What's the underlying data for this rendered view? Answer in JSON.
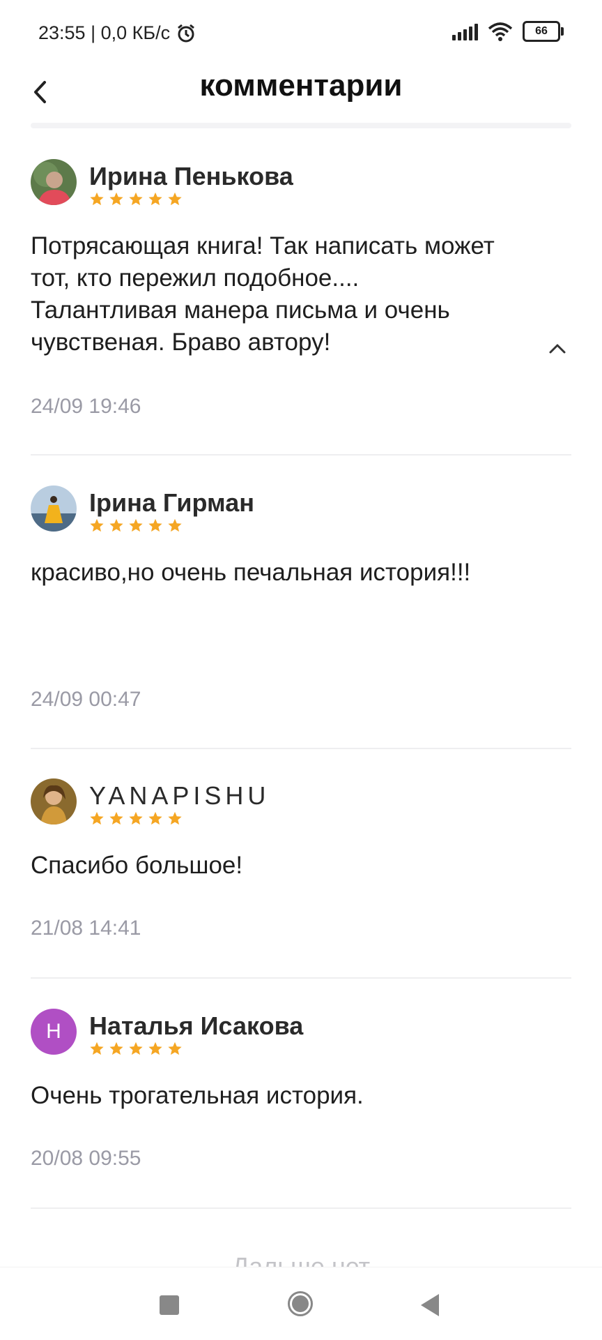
{
  "status_bar": {
    "time_speed": "23:55 | 0,0 КБ/с",
    "battery": "66",
    "icons": [
      "alarm-icon",
      "signal-icon",
      "wifi-icon",
      "battery-icon"
    ]
  },
  "header": {
    "title": "комментарии",
    "back_icon": "chevron-left-icon"
  },
  "comments": [
    {
      "author": "Ирина Пенькова",
      "rating": 5,
      "text": "Потрясающая книга! Так написать может тот, кто пережил подобное.... Талантливая манера письма и очень чувственая. Браво автору!",
      "date": "24/09 19:46",
      "avatar": "photo"
    },
    {
      "author": "Ірина Гирман",
      "rating": 5,
      "text": "красиво,но очень печальная история!!!",
      "date": "24/09 00:47",
      "avatar": "photo"
    },
    {
      "author": "YANAPISHU",
      "rating": 5,
      "text": "Спасибо большое!",
      "date": "21/08 14:41",
      "avatar": "photo"
    },
    {
      "author": "Наталья Исакова",
      "rating": 5,
      "text": "Очень трогательная история.",
      "date": "20/08 09:55",
      "avatar_initial": "Н"
    }
  ],
  "footer": {
    "end_label": "Дальше нет"
  },
  "colors": {
    "star": "#f5a623",
    "initial_avatar": "#b04fc4",
    "date": "#9a9aa5"
  }
}
